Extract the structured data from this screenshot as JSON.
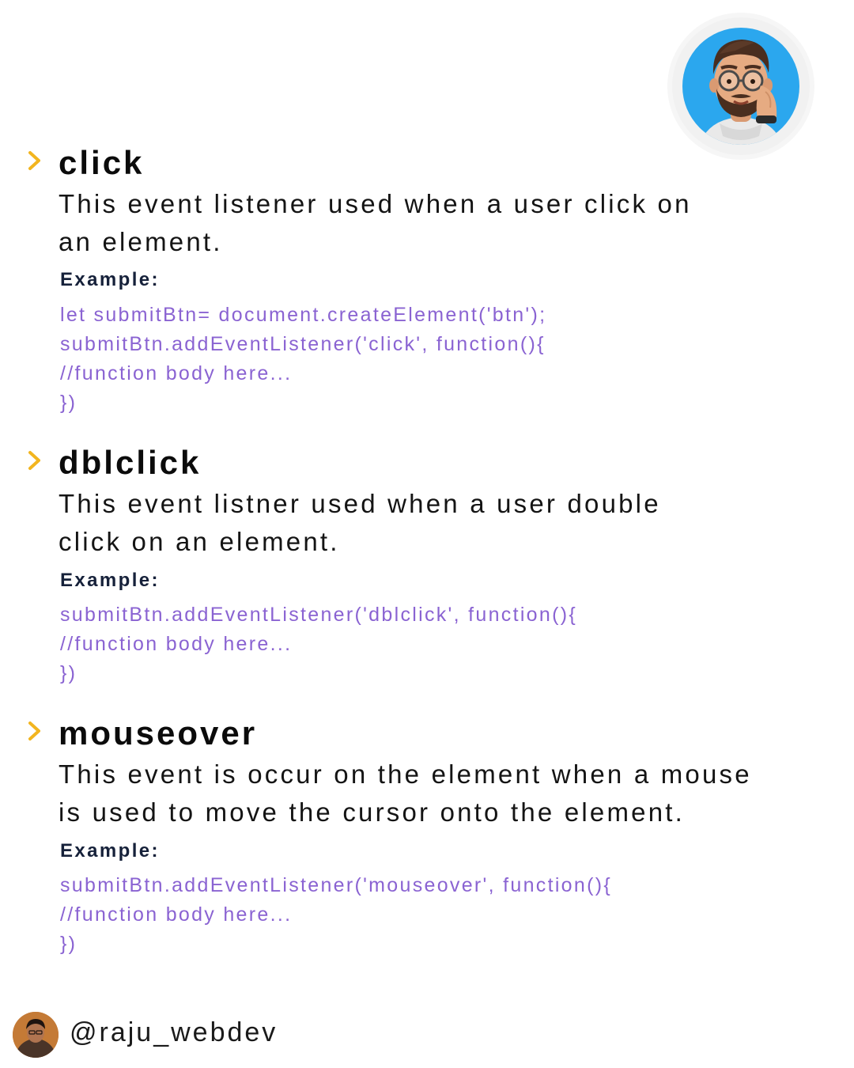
{
  "sections": [
    {
      "title": "click",
      "description": [
        "This event listener used when a user click on",
        "an element."
      ],
      "example_label": "Example:",
      "code": [
        "let submitBtn= document.createElement('btn');",
        "submitBtn.addEventListener('click', function(){",
        "//function body here...",
        "})"
      ]
    },
    {
      "title": "dblclick",
      "description": [
        "This event listner used when a user double",
        "click on an element."
      ],
      "example_label": "Example:",
      "code": [
        "submitBtn.addEventListener('dblclick', function(){",
        "//function body here...",
        "})"
      ]
    },
    {
      "title": "mouseover",
      "description": [
        "This event is occur on the element when a mouse",
        "is used to move the cursor onto the element."
      ],
      "example_label": "Example:",
      "code": [
        "submitBtn.addEventListener('mouseover', function(){",
        "//function body here...",
        "})"
      ]
    }
  ],
  "footer": {
    "handle": "@raju_webdev"
  },
  "colors": {
    "chevron": "#f2b51f",
    "code": "#8a63d2",
    "example_label": "#16213a",
    "memoji_bg": "#2ba7ee"
  },
  "icons": {
    "bullet": "chevron-right-icon",
    "top_avatar": "memoji-avatar",
    "footer_avatar": "profile-avatar"
  }
}
